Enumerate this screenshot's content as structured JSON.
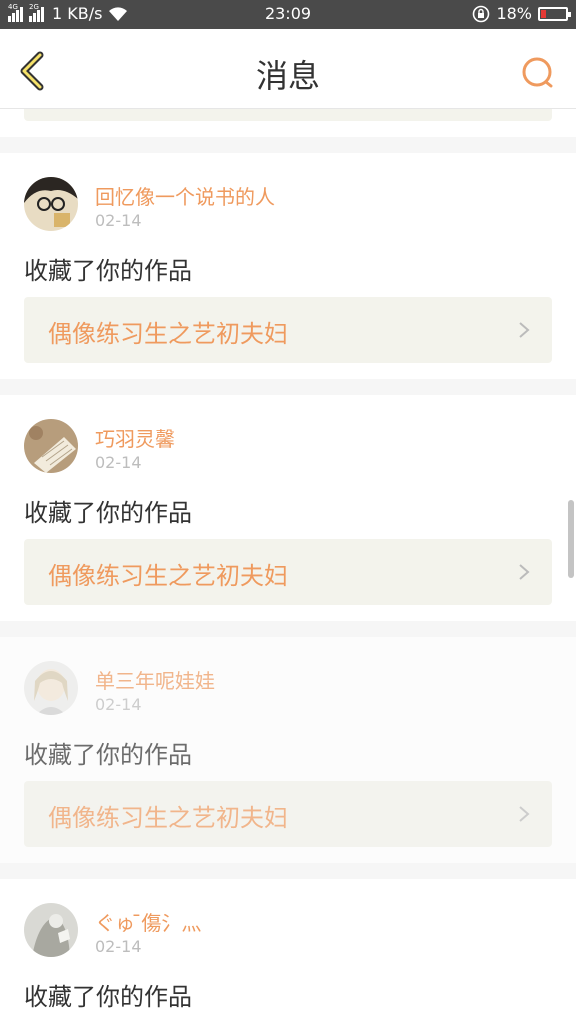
{
  "status_bar": {
    "network_label_1": "4G",
    "network_label_2": "2G",
    "speed": "1 KB/s",
    "time": "23:09",
    "battery": "18%",
    "battery_color": "#e53935"
  },
  "header": {
    "title": "消息",
    "back_icon": "chevron-left-icon",
    "search_icon": "search-icon",
    "accent_color": "#ef9a5e"
  },
  "notifications": [
    {
      "user": "回忆像一个说书的人",
      "date": "02-14",
      "action": "收藏了你的作品",
      "work": "偶像练习生之艺初夫妇"
    },
    {
      "user": "巧羽灵馨",
      "date": "02-14",
      "action": "收藏了你的作品",
      "work": "偶像练习生之艺初夫妇"
    },
    {
      "user": "单三年呢娃娃",
      "date": "02-14",
      "action": "收藏了你的作品",
      "work": "偶像练习生之艺初夫妇"
    },
    {
      "user": "ぐゅ ̄傷氵灬",
      "date": "02-14",
      "action": "收藏了你的作品"
    }
  ]
}
